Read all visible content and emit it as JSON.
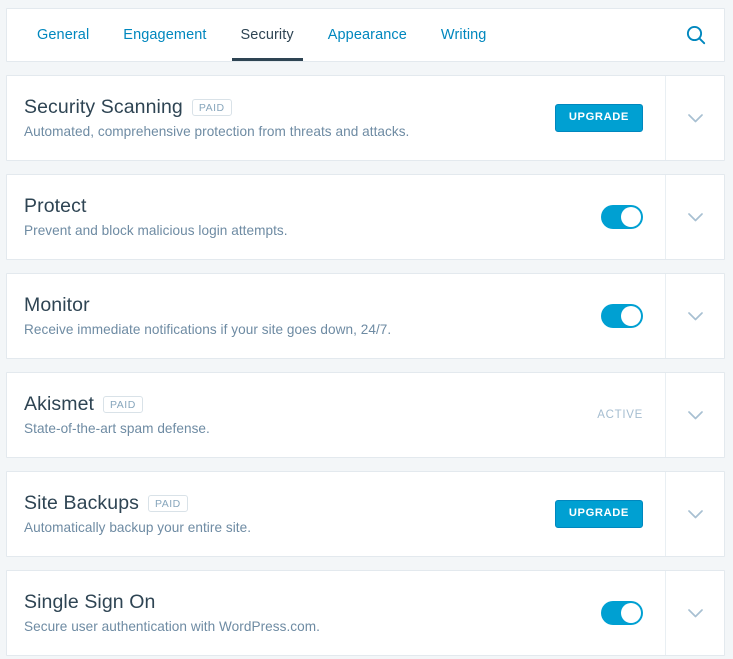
{
  "nav": {
    "tabs": [
      {
        "label": "General",
        "active": false
      },
      {
        "label": "Engagement",
        "active": false
      },
      {
        "label": "Security",
        "active": true
      },
      {
        "label": "Appearance",
        "active": false
      },
      {
        "label": "Writing",
        "active": false
      }
    ],
    "search_icon": "search-icon"
  },
  "colors": {
    "accent": "#00a0d2",
    "link": "#0087be",
    "title": "#2e4453",
    "description": "#6e8ba3",
    "badge_text": "#87a6bc",
    "status_text": "#a5bdd0",
    "page_background": "#f3f6f8",
    "card_border": "#e3e9ee"
  },
  "cards": [
    {
      "title": "Security Scanning",
      "badge": "PAID",
      "description": "Automated, comprehensive protection from threats and attacks.",
      "control": "button",
      "button_label": "UPGRADE",
      "expand_icon": "chevron-down-icon"
    },
    {
      "title": "Protect",
      "badge": null,
      "description": "Prevent and block malicious login attempts.",
      "control": "toggle",
      "toggle_on": true,
      "expand_icon": "chevron-down-icon"
    },
    {
      "title": "Monitor",
      "badge": null,
      "description": "Receive immediate notifications if your site goes down, 24/7.",
      "control": "toggle",
      "toggle_on": true,
      "expand_icon": "chevron-down-icon"
    },
    {
      "title": "Akismet",
      "badge": "PAID",
      "description": "State-of-the-art spam defense.",
      "control": "status",
      "status_label": "ACTIVE",
      "expand_icon": "chevron-down-icon"
    },
    {
      "title": "Site Backups",
      "badge": "PAID",
      "description": "Automatically backup your entire site.",
      "control": "button",
      "button_label": "UPGRADE",
      "expand_icon": "chevron-down-icon"
    },
    {
      "title": "Single Sign On",
      "badge": null,
      "description": "Secure user authentication with WordPress.com.",
      "control": "toggle",
      "toggle_on": true,
      "expand_icon": "chevron-down-icon"
    }
  ]
}
